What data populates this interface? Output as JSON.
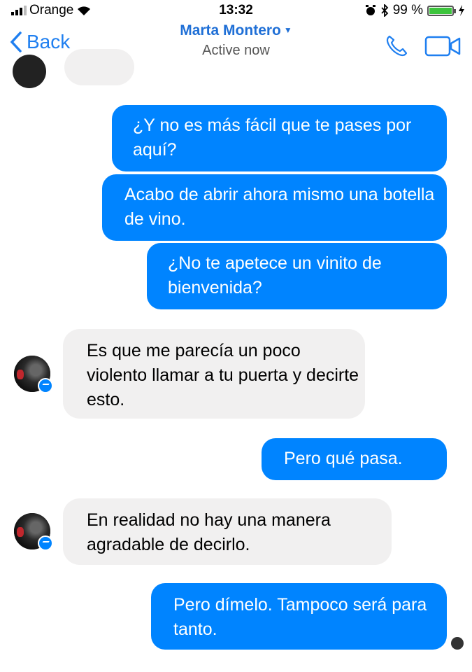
{
  "status_bar": {
    "carrier": "Orange",
    "time": "13:32",
    "battery": "99 %",
    "battery_level": 0.99
  },
  "header": {
    "back_label": "Back",
    "contact_name": "Marta Montero",
    "presence": "Active now",
    "accent_color": "#1f7ff0"
  },
  "messages": [
    {
      "direction": "out",
      "text": "¿Y no es más fácil que te pases por aquí?"
    },
    {
      "direction": "out",
      "text": "Acabo de abrir ahora mismo una botella de vino."
    },
    {
      "direction": "out",
      "text": "¿No te apetece un vinito de bienvenida?"
    },
    {
      "direction": "in",
      "text": "Es que me parecía un poco violento llamar a tu puerta y decirte esto."
    },
    {
      "direction": "out",
      "text": "Pero qué pasa."
    },
    {
      "direction": "in",
      "text": "En realidad no hay una manera agradable de decirlo."
    },
    {
      "direction": "out",
      "text": "Pero dímelo. Tampoco será para tanto."
    }
  ],
  "colors": {
    "outgoing_bubble": "#0084ff",
    "incoming_bubble": "#f1f0f0"
  },
  "icons": [
    "signal-icon",
    "wifi-icon",
    "alarm-icon",
    "bluetooth-icon",
    "battery-icon",
    "charging-icon",
    "back-chevron-icon",
    "phone-icon",
    "video-icon",
    "messenger-badge-icon",
    "seen-avatar-icon"
  ]
}
